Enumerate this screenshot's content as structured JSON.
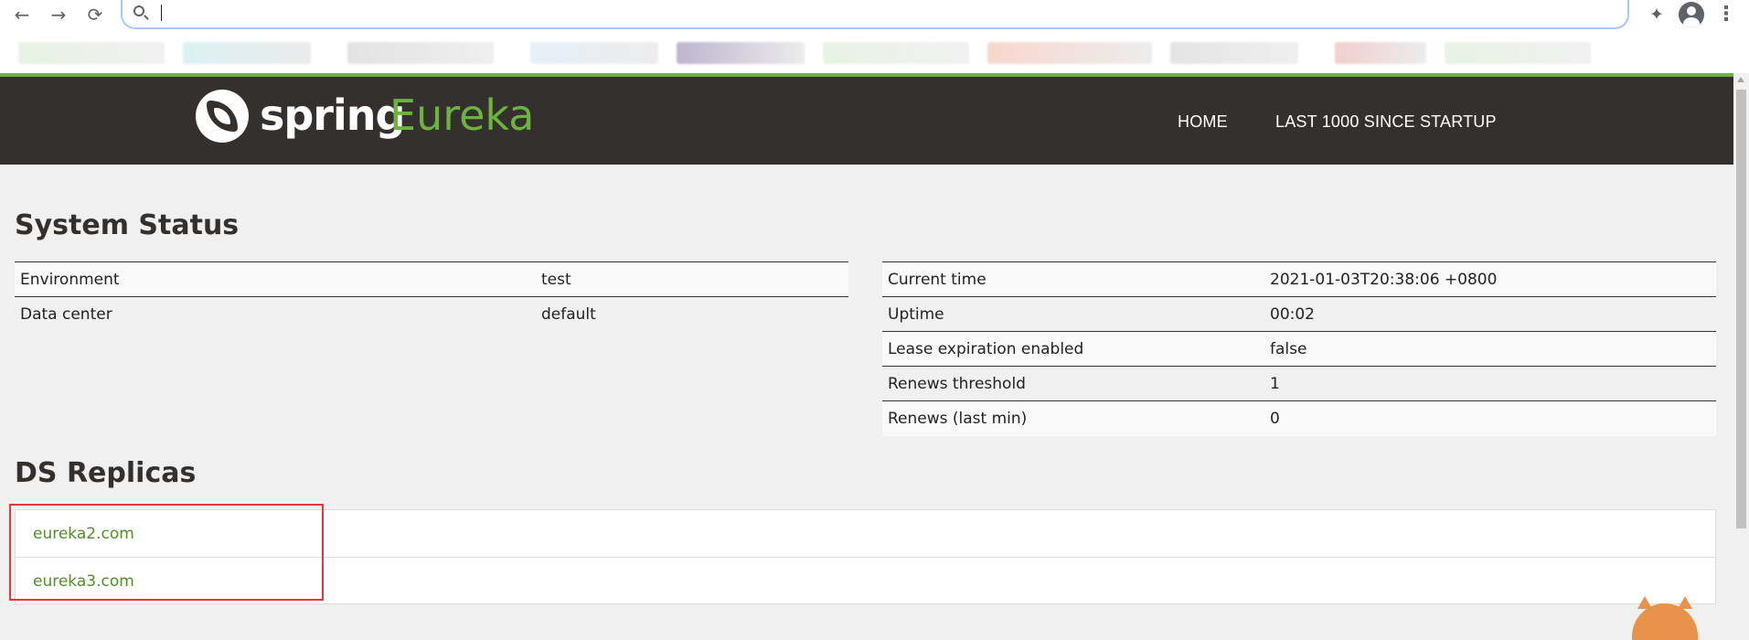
{
  "browser": {
    "back_icon": "arrow-left-icon",
    "forward_icon": "arrow-right-icon",
    "reload_icon": "reload-icon",
    "address_value": "",
    "colors": {
      "omnibox_border": "#a8c7fa",
      "accent": "#6db33f"
    }
  },
  "header": {
    "logo_spring": "spring",
    "logo_eureka": "Eureka",
    "nav": {
      "home": "HOME",
      "last1000": "LAST 1000 SINCE STARTUP"
    },
    "colors": {
      "background": "#34302d",
      "brand_green": "#6db33f"
    }
  },
  "system_status": {
    "title": "System Status",
    "left": [
      {
        "key": "Environment",
        "value": "test"
      },
      {
        "key": "Data center",
        "value": "default"
      }
    ],
    "right": [
      {
        "key": "Current time",
        "value": "2021-01-03T20:38:06 +0800"
      },
      {
        "key": "Uptime",
        "value": "00:02"
      },
      {
        "key": "Lease expiration enabled",
        "value": "false"
      },
      {
        "key": "Renews threshold",
        "value": "1"
      },
      {
        "key": "Renews (last min)",
        "value": "0"
      }
    ]
  },
  "ds_replicas": {
    "title": "DS Replicas",
    "items": [
      "eureka2.com",
      "eureka3.com"
    ],
    "link_color": "#548d2a",
    "highlight_color": "#e53935"
  }
}
